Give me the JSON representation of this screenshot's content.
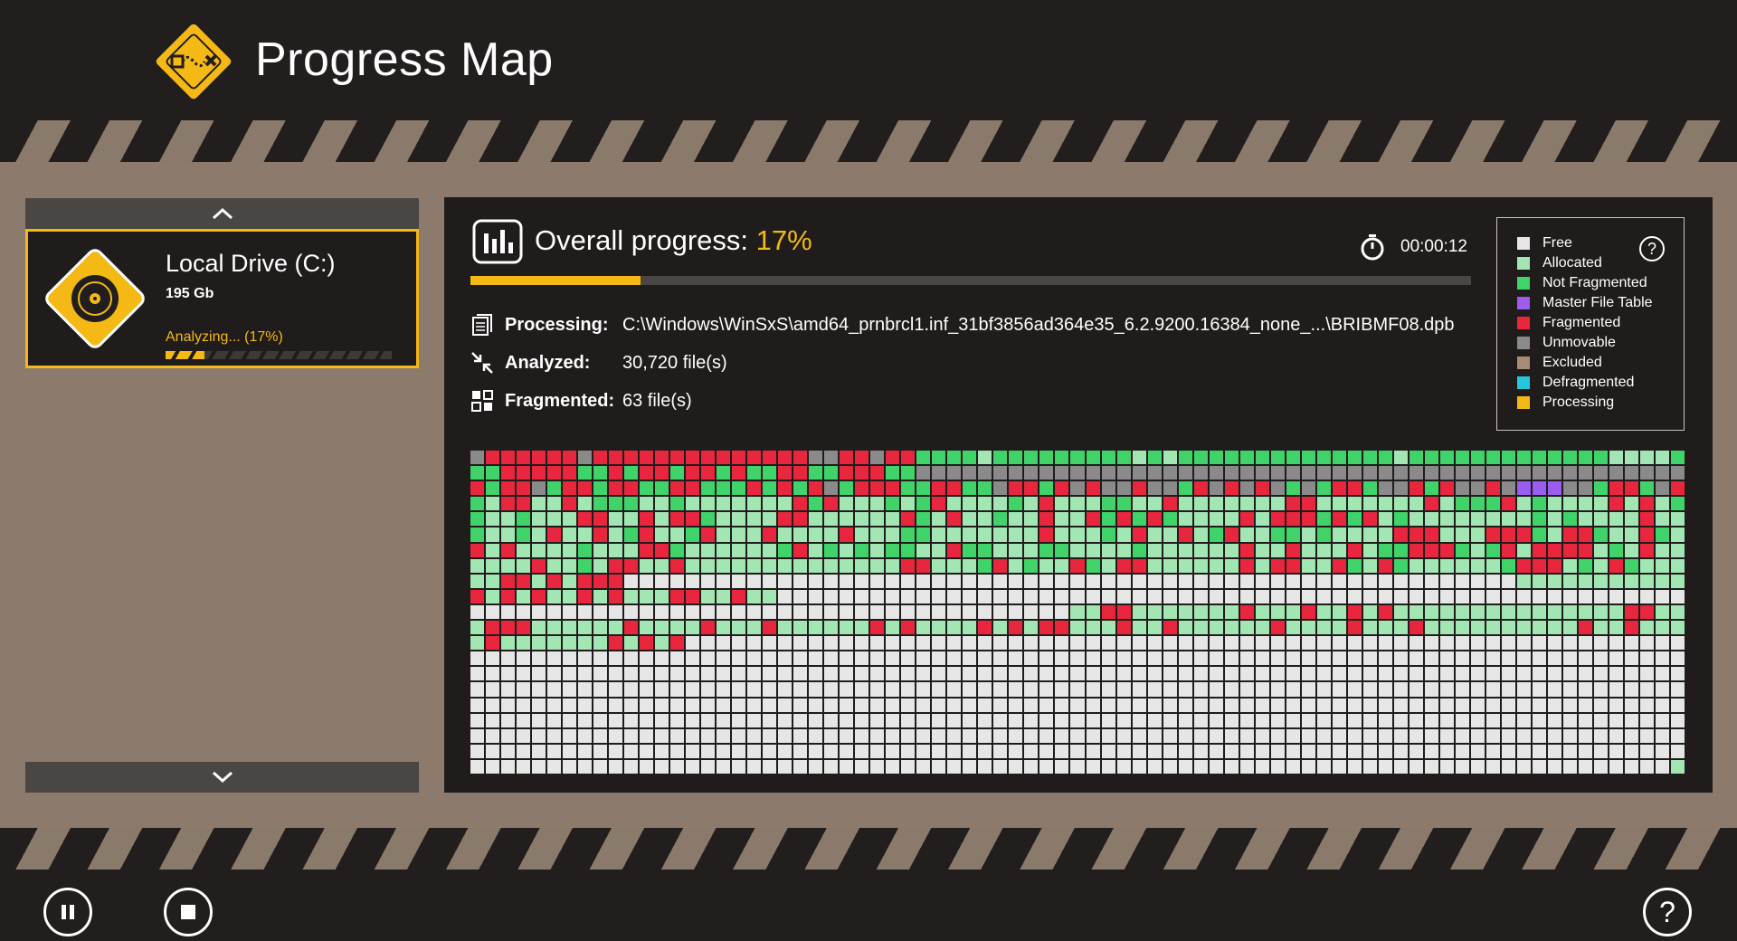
{
  "app": {
    "title": "Progress Map"
  },
  "drive": {
    "name": "Local Drive (C:)",
    "size": "195 Gb",
    "status": "Analyzing... (17%)",
    "progress": 0.17
  },
  "overall": {
    "label": "Overall progress:",
    "value": "17%",
    "progress": 0.17,
    "timer": "00:00:12"
  },
  "info": {
    "processing_label": "Processing:",
    "processing_value": "C:\\Windows\\WinSxS\\amd64_prnbrcl1.inf_31bf3856ad364e35_6.2.9200.16384_none_...\\BRIBMF08.dpb",
    "analyzed_label": "Analyzed:",
    "analyzed_value": "30,720 file(s)",
    "fragmented_label": "Fragmented:",
    "fragmented_value": "63 file(s)"
  },
  "legend": [
    {
      "label": "Free",
      "color": "#e6e6e6"
    },
    {
      "label": "Allocated",
      "color": "#a2e6b4"
    },
    {
      "label": "Not Fragmented",
      "color": "#3fd36a"
    },
    {
      "label": "Master File Table",
      "color": "#9b5cf0"
    },
    {
      "label": "Fragmented",
      "color": "#e8273f"
    },
    {
      "label": "Unmovable",
      "color": "#8a8a8a"
    },
    {
      "label": "Excluded",
      "color": "#a88b76"
    },
    {
      "label": "Defragmented",
      "color": "#26c7d9"
    },
    {
      "label": "Processing",
      "color": "#f5b915"
    }
  ],
  "icons": {
    "logo": "route-map-logo-icon",
    "drive": "disk-drive-icon",
    "progress": "bar-chart-icon",
    "timer": "stopwatch-icon",
    "processing": "document-icon",
    "analyzed": "compress-arrows-icon",
    "fragmented": "fragment-grid-icon",
    "scroll_up": "chevron-up-icon",
    "scroll_down": "chevron-down-icon",
    "pause": "pause-icon",
    "stop": "stop-icon",
    "help": "help-icon"
  },
  "controls": {
    "help_glyph": "?"
  }
}
